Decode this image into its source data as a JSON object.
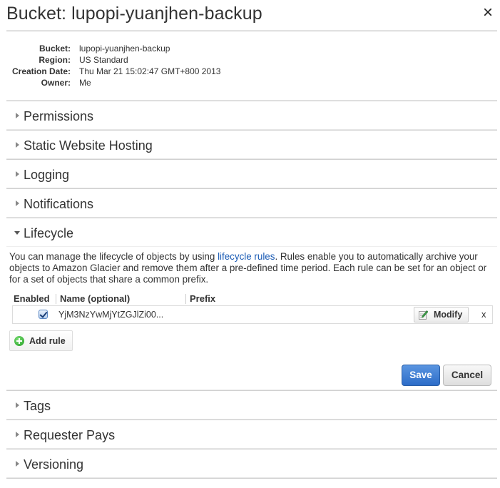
{
  "header": {
    "title": "Bucket: lupopi-yuanjhen-backup",
    "close_glyph": "×"
  },
  "properties": [
    {
      "key": "Bucket:",
      "value": "lupopi-yuanjhen-backup"
    },
    {
      "key": "Region:",
      "value": "US Standard"
    },
    {
      "key": "Creation Date:",
      "value": "Thu Mar 21 15:02:47 GMT+800 2013"
    },
    {
      "key": "Owner:",
      "value": "Me"
    }
  ],
  "sections": {
    "permissions": "Permissions",
    "static_website_hosting": "Static Website Hosting",
    "logging": "Logging",
    "notifications": "Notifications",
    "lifecycle": "Lifecycle",
    "tags": "Tags",
    "requester_pays": "Requester Pays",
    "versioning": "Versioning"
  },
  "lifecycle": {
    "description_before": "You can manage the lifecycle of objects by using ",
    "description_link": "lifecycle rules",
    "description_after": ". Rules enable you to automatically archive your objects to Amazon Glacier and remove them after a pre-defined time period. Each rule can be set for an object or for a set of objects that share a common prefix.",
    "columns": {
      "enabled": "Enabled",
      "name": "Name (optional)",
      "prefix": "Prefix"
    },
    "rules": [
      {
        "enabled": true,
        "name": "YjM3NzYwMjYtZGJlZi00...",
        "prefix": "",
        "modify_label": "Modify",
        "remove_glyph": "x"
      }
    ],
    "add_rule_label": "Add rule",
    "save_label": "Save",
    "cancel_label": "Cancel"
  },
  "colors": {
    "link": "#1a5bb5",
    "save_button": "#2c6cc8",
    "add_icon": "#1c9a1c"
  }
}
